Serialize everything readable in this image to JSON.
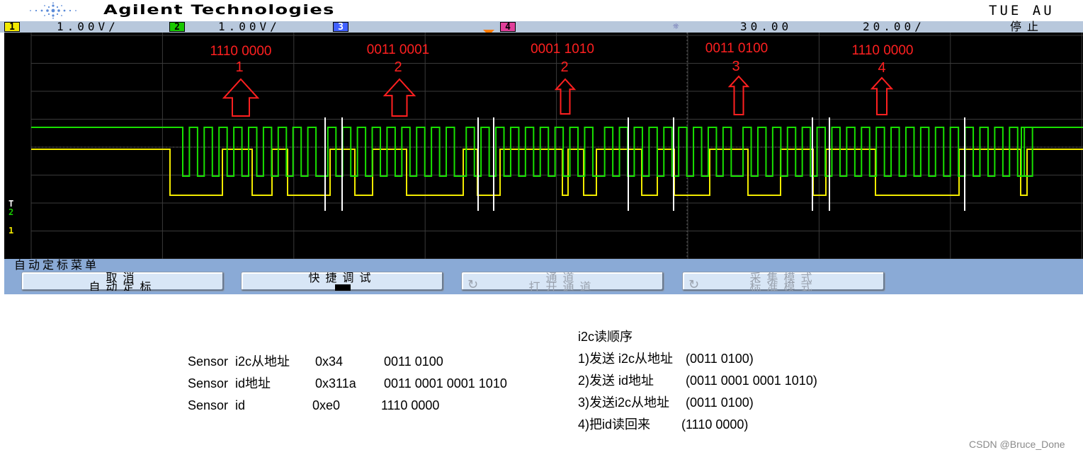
{
  "header": {
    "brand": "Agilent Technologies",
    "date_fragment": "TUE AU"
  },
  "statusbar": {
    "ch1_label": "1",
    "ch1_scale": "1.00V/",
    "ch2_label": "2",
    "ch2_scale": "1.00V/",
    "ch3_label": "3",
    "ch4_label": "4",
    "delay_icon": "☼",
    "delay": "30.00",
    "timebase": "20.00/",
    "run_state": "停止"
  },
  "markers": {
    "trigger": "T",
    "ch2": "2",
    "ch1": "1"
  },
  "annotations": [
    {
      "byte": "1110 0000",
      "index": "1"
    },
    {
      "byte": "0011 0001",
      "index": "2"
    },
    {
      "byte": "0001 1010",
      "index": "2"
    },
    {
      "byte": "0011 0100",
      "index": "3"
    },
    {
      "byte": "1110 0000",
      "index": "4"
    }
  ],
  "menu": {
    "title": "自动定标菜单",
    "softkeys": [
      {
        "line1": "取消",
        "line2": "自动定标",
        "icon": "",
        "enabled": true
      },
      {
        "line1": "快捷调试",
        "line2": "",
        "icon": "block-icon",
        "enabled": true
      },
      {
        "line1": "通道",
        "line2": "打开通道",
        "icon": "rotate-icon",
        "enabled": false
      },
      {
        "line1": "采集模式",
        "line2": "标准模式",
        "icon": "rotate-icon",
        "enabled": false
      }
    ]
  },
  "sensor_info": [
    {
      "name": "Sensor  i2c从地址",
      "hex": "0x34",
      "bin": "0011 0100"
    },
    {
      "name": "Sensor  id地址",
      "hex": "0x311a",
      "bin": "0011 0001 0001 1010"
    },
    {
      "name": "Sensor  id",
      "hex": "0xe0",
      "bin": "1110 0000"
    }
  ],
  "read_order": {
    "title": "i2c读顺序",
    "steps": [
      {
        "text": "1)发送 i2c从地址",
        "value": "(0011 0100)"
      },
      {
        "text": "2)发送 id地址",
        "value": "(0011 0001 0001 1010)"
      },
      {
        "text": "3)发送i2c从地址",
        "value": "(0011 0100)"
      },
      {
        "text": "4)把id读回来",
        "value": "(1110 0000)"
      }
    ]
  },
  "watermark": "CSDN @Bruce_Done",
  "colors": {
    "scl": "#18e000",
    "sda": "#f2ea00",
    "grid": "#3a3a3a",
    "annotation": "#ff2020",
    "menu_bg": "#8aaad6"
  }
}
